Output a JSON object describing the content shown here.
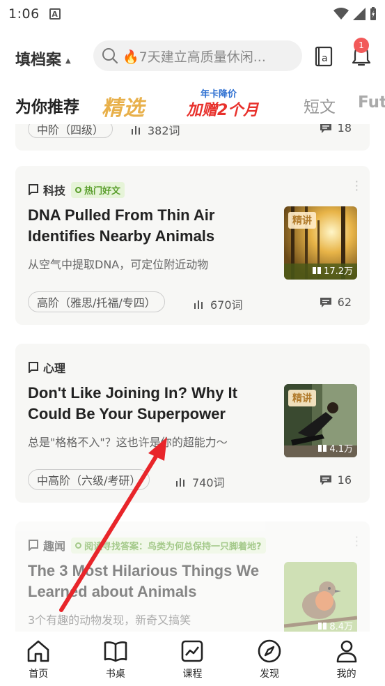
{
  "status": {
    "time": "1:06"
  },
  "top": {
    "channel": "填档案",
    "search_placeholder": "🔥7天建立高质量休闲...",
    "notif_count": "1"
  },
  "tabs": [
    {
      "label": "为你推荐"
    },
    {
      "label": "精选"
    },
    {
      "promo_top": "年卡降价",
      "promo_bottom": "加赠2个月"
    },
    {
      "label": "短文"
    },
    {
      "label": "Futu"
    }
  ],
  "partial_card": {
    "level": "中阶（四级）",
    "words": "382词",
    "comments": "18"
  },
  "cards": [
    {
      "category": "科技",
      "hot": "热门好文",
      "title": "DNA Pulled From Thin Air Identifies Nearby Animals",
      "subtitle": "从空气中提取DNA，可定位附近动物",
      "thumb_tag": "精讲",
      "views": "17.2万",
      "level": "高阶（雅思/托福/专四）",
      "words": "670词",
      "comments": "62"
    },
    {
      "category": "心理",
      "title": "Don't Like Joining In? Why It Could Be Your Superpower",
      "subtitle": "总是\"格格不入\"？这也许是你的超能力～",
      "thumb_tag": "精讲",
      "views": "4.1万",
      "level": "中高阶（六级/考研）",
      "words": "740词",
      "comments": "16"
    },
    {
      "category": "趣闻",
      "hot": "阅读寻找答案：鸟类为何总保持一只脚着地?",
      "title": "The 3 Most Hilarious Things We Learned about Animals",
      "subtitle": "3个有趣的动物发现，新奇又搞笑",
      "views": "8.4万"
    }
  ],
  "nav": [
    {
      "label": "首页",
      "icon": "home-icon"
    },
    {
      "label": "书桌",
      "icon": "book-icon"
    },
    {
      "label": "课程",
      "icon": "chart-icon"
    },
    {
      "label": "发现",
      "icon": "compass-icon"
    },
    {
      "label": "我的",
      "icon": "person-icon"
    }
  ],
  "colors": {
    "accent_green": "#5a9e2c",
    "badge_red": "#f25a5a",
    "arrow_red": "#e8252a",
    "featured_gold": "#e8b04a"
  }
}
